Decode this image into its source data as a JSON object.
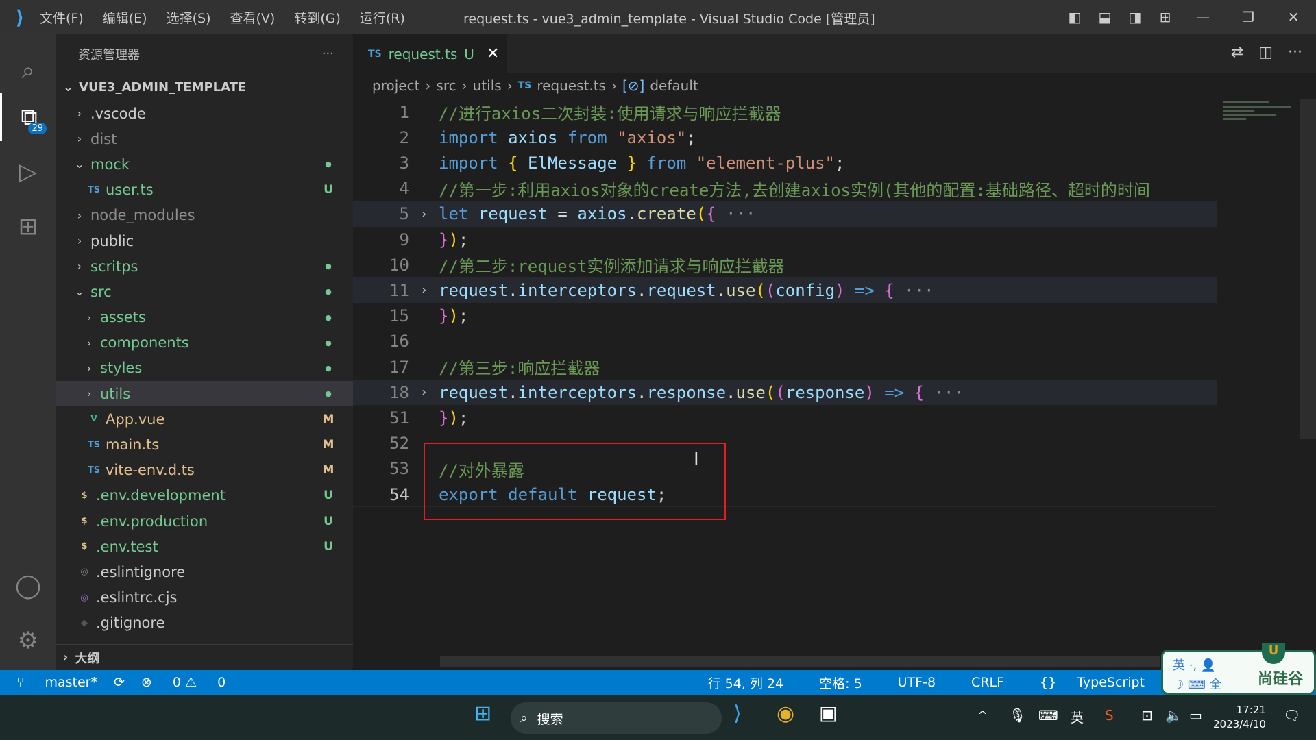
{
  "titlebar": {
    "menu": [
      "文件(F)",
      "编辑(E)",
      "选择(S)",
      "查看(V)",
      "转到(G)",
      "运行(R)"
    ],
    "title": "request.ts - vue3_admin_template - Visual Studio Code [管理员]"
  },
  "activity": {
    "explorer_badge": "29"
  },
  "sidebar": {
    "title": "资源管理器",
    "more": "···",
    "project": "VUE3_ADMIN_TEMPLATE",
    "items": [
      {
        "name": ".vscode",
        "depth": 1,
        "kind": "folder",
        "expanded": false,
        "color": "#cccccc",
        "status": ""
      },
      {
        "name": "dist",
        "depth": 1,
        "kind": "folder",
        "expanded": false,
        "color": "#8c8c8c",
        "status": ""
      },
      {
        "name": "mock",
        "depth": 1,
        "kind": "folder",
        "expanded": true,
        "color": "#73c991",
        "status": "●"
      },
      {
        "name": "user.ts",
        "depth": 2,
        "kind": "ts",
        "color": "#73c991",
        "status": "U"
      },
      {
        "name": "node_modules",
        "depth": 1,
        "kind": "folder",
        "expanded": false,
        "color": "#8c8c8c",
        "status": ""
      },
      {
        "name": "public",
        "depth": 1,
        "kind": "folder",
        "expanded": false,
        "color": "#cccccc",
        "status": ""
      },
      {
        "name": "scritps",
        "depth": 1,
        "kind": "folder",
        "expanded": false,
        "color": "#73c991",
        "status": "●"
      },
      {
        "name": "src",
        "depth": 1,
        "kind": "folder",
        "expanded": true,
        "color": "#73c991",
        "status": "●"
      },
      {
        "name": "assets",
        "depth": 2,
        "kind": "folder",
        "expanded": false,
        "color": "#73c991",
        "status": "●"
      },
      {
        "name": "components",
        "depth": 2,
        "kind": "folder",
        "expanded": false,
        "color": "#73c991",
        "status": "●"
      },
      {
        "name": "styles",
        "depth": 2,
        "kind": "folder",
        "expanded": false,
        "color": "#73c991",
        "status": "●"
      },
      {
        "name": "utils",
        "depth": 2,
        "kind": "folder",
        "expanded": false,
        "color": "#73c991",
        "status": "●",
        "selected": true
      },
      {
        "name": "App.vue",
        "depth": 2,
        "kind": "vue",
        "color": "#e2c08d",
        "status": "M"
      },
      {
        "name": "main.ts",
        "depth": 2,
        "kind": "ts",
        "color": "#e2c08d",
        "status": "M"
      },
      {
        "name": "vite-env.d.ts",
        "depth": 2,
        "kind": "ts",
        "color": "#e2c08d",
        "status": "M"
      },
      {
        "name": ".env.development",
        "depth": 1,
        "kind": "env",
        "color": "#73c991",
        "status": "U"
      },
      {
        "name": ".env.production",
        "depth": 1,
        "kind": "env",
        "color": "#73c991",
        "status": "U"
      },
      {
        "name": ".env.test",
        "depth": 1,
        "kind": "env",
        "color": "#73c991",
        "status": "U"
      },
      {
        "name": ".eslintignore",
        "depth": 1,
        "kind": "eslint",
        "color": "#cccccc",
        "status": ""
      },
      {
        "name": ".eslintrc.cjs",
        "depth": 1,
        "kind": "eslintrc",
        "color": "#cccccc",
        "status": ""
      },
      {
        "name": ".gitignore",
        "depth": 1,
        "kind": "git",
        "color": "#cccccc",
        "status": ""
      }
    ],
    "outline": "大纲"
  },
  "tab": {
    "lang": "TS",
    "name": "request.ts",
    "status": "U",
    "close": "✕"
  },
  "breadcrumb": {
    "parts": [
      "project",
      "src",
      "utils"
    ],
    "lang": "TS",
    "file": "request.ts",
    "symbol": "default"
  },
  "code": [
    {
      "n": "1",
      "t": [
        [
          "//进行axios二次封装:使用请求与响应拦截器",
          "cm"
        ]
      ]
    },
    {
      "n": "2",
      "t": [
        [
          "import",
          "kw"
        ],
        [
          " axios ",
          "var"
        ],
        [
          "from",
          "kw"
        ],
        [
          " ",
          ""
        ],
        [
          "\"axios\"",
          "str"
        ],
        [
          ";",
          "pun"
        ]
      ]
    },
    {
      "n": "3",
      "t": [
        [
          "import",
          "kw"
        ],
        [
          " ",
          ""
        ],
        [
          "{",
          "br"
        ],
        [
          " ElMessage ",
          "var"
        ],
        [
          "}",
          "br"
        ],
        [
          " ",
          ""
        ],
        [
          "from",
          "kw"
        ],
        [
          " ",
          ""
        ],
        [
          "\"element-plus\"",
          "str"
        ],
        [
          ";",
          "pun"
        ]
      ]
    },
    {
      "n": "4",
      "t": [
        [
          "//第一步:利用axios对象的create方法,去创建axios实例(其他的配置:基础路径、超时的时间",
          "cm"
        ]
      ]
    },
    {
      "n": "5",
      "fold": true,
      "t": [
        [
          "let",
          "kw"
        ],
        [
          " request ",
          "var"
        ],
        [
          "= ",
          "pun"
        ],
        [
          "axios",
          "var"
        ],
        [
          ".",
          "pun"
        ],
        [
          "create",
          "fn"
        ],
        [
          "(",
          "br"
        ],
        [
          "{",
          "br2"
        ],
        [
          " ···",
          "dim"
        ]
      ]
    },
    {
      "n": "9",
      "t": [
        [
          "}",
          "br2"
        ],
        [
          ")",
          "br"
        ],
        [
          ";",
          "pun"
        ]
      ]
    },
    {
      "n": "10",
      "t": [
        [
          "//第二步:request实例添加请求与响应拦截器",
          "cm"
        ]
      ]
    },
    {
      "n": "11",
      "fold": true,
      "t": [
        [
          "request",
          "var"
        ],
        [
          ".",
          "pun"
        ],
        [
          "interceptors",
          "var"
        ],
        [
          ".",
          "pun"
        ],
        [
          "request",
          "var"
        ],
        [
          ".",
          "pun"
        ],
        [
          "use",
          "fn"
        ],
        [
          "(",
          "br"
        ],
        [
          "(",
          "br2"
        ],
        [
          "config",
          "var"
        ],
        [
          ")",
          "br2"
        ],
        [
          " => ",
          "kw"
        ],
        [
          "{",
          "br2"
        ],
        [
          " ···",
          "dim"
        ]
      ]
    },
    {
      "n": "15",
      "t": [
        [
          "}",
          "br2"
        ],
        [
          ")",
          "br"
        ],
        [
          ";",
          "pun"
        ]
      ]
    },
    {
      "n": "16",
      "t": []
    },
    {
      "n": "17",
      "t": [
        [
          "//第三步:响应拦截器",
          "cm"
        ]
      ]
    },
    {
      "n": "18",
      "fold": true,
      "t": [
        [
          "request",
          "var"
        ],
        [
          ".",
          "pun"
        ],
        [
          "interceptors",
          "var"
        ],
        [
          ".",
          "pun"
        ],
        [
          "response",
          "var"
        ],
        [
          ".",
          "pun"
        ],
        [
          "use",
          "fn"
        ],
        [
          "(",
          "br"
        ],
        [
          "(",
          "br2"
        ],
        [
          "response",
          "var"
        ],
        [
          ")",
          "br2"
        ],
        [
          " => ",
          "kw"
        ],
        [
          "{",
          "br2"
        ],
        [
          " ···",
          "dim"
        ]
      ]
    },
    {
      "n": "51",
      "t": [
        [
          "}",
          "br2"
        ],
        [
          ")",
          "br"
        ],
        [
          ";",
          "pun"
        ]
      ]
    },
    {
      "n": "52",
      "t": []
    },
    {
      "n": "53",
      "t": [
        [
          "//对外暴露",
          "cm"
        ]
      ]
    },
    {
      "n": "54",
      "current": true,
      "t": [
        [
          "export",
          "kw"
        ],
        [
          " ",
          ""
        ],
        [
          "default",
          "kw"
        ],
        [
          " request",
          "var"
        ],
        [
          ";",
          "pun"
        ]
      ]
    }
  ],
  "statusbar": {
    "branch": "master*",
    "errors": "0",
    "warnings": "0",
    "position": "行 54, 列 24",
    "spaces": "空格: 5",
    "encoding": "UTF-8",
    "eol": "CRLF",
    "language": "TypeScript"
  },
  "ime": {
    "row1": "英 ·, 👤",
    "row2": "☽ ⌨ 全",
    "brand": "尚硅谷",
    "clip": "U"
  },
  "taskbar": {
    "search": "搜索",
    "lang": "英",
    "time": "17:21",
    "date": "2023/4/10"
  },
  "colors": {
    "accent": "#007acc",
    "highlight_box": "#e51c23"
  }
}
